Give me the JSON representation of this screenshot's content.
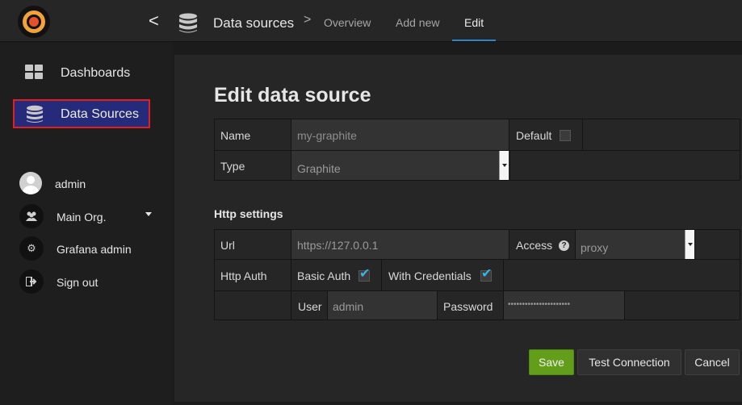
{
  "nav": {
    "back_glyph": "<",
    "section_title": "Data sources",
    "separator": ">",
    "tabs": [
      {
        "label": "Overview"
      },
      {
        "label": "Add new"
      },
      {
        "label": "Edit"
      }
    ],
    "active_tab": "Edit",
    "accent": "#2f83c7"
  },
  "sidebar": {
    "items": [
      {
        "label": "Dashboards",
        "icon": "grid-icon"
      },
      {
        "label": "Data Sources",
        "icon": "database-icon"
      }
    ],
    "user": {
      "name": "admin",
      "org": "Main Org.",
      "admin_link": "Grafana admin",
      "sign_out": "Sign out"
    },
    "highlight_color": "#e02020"
  },
  "form": {
    "title": "Edit data source",
    "name_label": "Name",
    "name_value": "my-graphite",
    "default_label": "Default",
    "default_checked": false,
    "type_label": "Type",
    "type_value": "Graphite",
    "http_section": "Http settings",
    "url_label": "Url",
    "url_value": "https://127.0.0.1",
    "access_label": "Access",
    "access_help": "?",
    "access_value": "proxy",
    "http_auth_label": "Http Auth",
    "basic_auth_label": "Basic Auth",
    "basic_auth_checked": true,
    "with_credentials_label": "With Credentials",
    "with_credentials_checked": true,
    "user_label": "User",
    "user_value": "admin",
    "password_label": "Password",
    "password_value": "••••••••••••••••••••••",
    "check_glyph": "✔"
  },
  "buttons": {
    "save": "Save",
    "test": "Test Connection",
    "cancel": "Cancel",
    "save_color": "#629e19"
  }
}
